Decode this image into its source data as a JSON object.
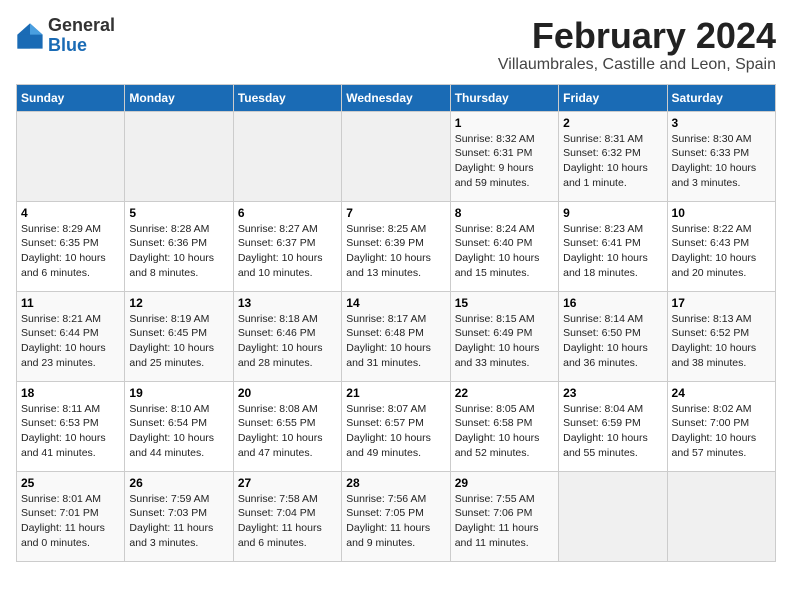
{
  "header": {
    "logo_general": "General",
    "logo_blue": "Blue",
    "month_title": "February 2024",
    "location": "Villaumbrales, Castille and Leon, Spain"
  },
  "columns": [
    "Sunday",
    "Monday",
    "Tuesday",
    "Wednesday",
    "Thursday",
    "Friday",
    "Saturday"
  ],
  "weeks": [
    [
      {
        "day": "",
        "info": ""
      },
      {
        "day": "",
        "info": ""
      },
      {
        "day": "",
        "info": ""
      },
      {
        "day": "",
        "info": ""
      },
      {
        "day": "1",
        "info": "Sunrise: 8:32 AM\nSunset: 6:31 PM\nDaylight: 9 hours\nand 59 minutes."
      },
      {
        "day": "2",
        "info": "Sunrise: 8:31 AM\nSunset: 6:32 PM\nDaylight: 10 hours\nand 1 minute."
      },
      {
        "day": "3",
        "info": "Sunrise: 8:30 AM\nSunset: 6:33 PM\nDaylight: 10 hours\nand 3 minutes."
      }
    ],
    [
      {
        "day": "4",
        "info": "Sunrise: 8:29 AM\nSunset: 6:35 PM\nDaylight: 10 hours\nand 6 minutes."
      },
      {
        "day": "5",
        "info": "Sunrise: 8:28 AM\nSunset: 6:36 PM\nDaylight: 10 hours\nand 8 minutes."
      },
      {
        "day": "6",
        "info": "Sunrise: 8:27 AM\nSunset: 6:37 PM\nDaylight: 10 hours\nand 10 minutes."
      },
      {
        "day": "7",
        "info": "Sunrise: 8:25 AM\nSunset: 6:39 PM\nDaylight: 10 hours\nand 13 minutes."
      },
      {
        "day": "8",
        "info": "Sunrise: 8:24 AM\nSunset: 6:40 PM\nDaylight: 10 hours\nand 15 minutes."
      },
      {
        "day": "9",
        "info": "Sunrise: 8:23 AM\nSunset: 6:41 PM\nDaylight: 10 hours\nand 18 minutes."
      },
      {
        "day": "10",
        "info": "Sunrise: 8:22 AM\nSunset: 6:43 PM\nDaylight: 10 hours\nand 20 minutes."
      }
    ],
    [
      {
        "day": "11",
        "info": "Sunrise: 8:21 AM\nSunset: 6:44 PM\nDaylight: 10 hours\nand 23 minutes."
      },
      {
        "day": "12",
        "info": "Sunrise: 8:19 AM\nSunset: 6:45 PM\nDaylight: 10 hours\nand 25 minutes."
      },
      {
        "day": "13",
        "info": "Sunrise: 8:18 AM\nSunset: 6:46 PM\nDaylight: 10 hours\nand 28 minutes."
      },
      {
        "day": "14",
        "info": "Sunrise: 8:17 AM\nSunset: 6:48 PM\nDaylight: 10 hours\nand 31 minutes."
      },
      {
        "day": "15",
        "info": "Sunrise: 8:15 AM\nSunset: 6:49 PM\nDaylight: 10 hours\nand 33 minutes."
      },
      {
        "day": "16",
        "info": "Sunrise: 8:14 AM\nSunset: 6:50 PM\nDaylight: 10 hours\nand 36 minutes."
      },
      {
        "day": "17",
        "info": "Sunrise: 8:13 AM\nSunset: 6:52 PM\nDaylight: 10 hours\nand 38 minutes."
      }
    ],
    [
      {
        "day": "18",
        "info": "Sunrise: 8:11 AM\nSunset: 6:53 PM\nDaylight: 10 hours\nand 41 minutes."
      },
      {
        "day": "19",
        "info": "Sunrise: 8:10 AM\nSunset: 6:54 PM\nDaylight: 10 hours\nand 44 minutes."
      },
      {
        "day": "20",
        "info": "Sunrise: 8:08 AM\nSunset: 6:55 PM\nDaylight: 10 hours\nand 47 minutes."
      },
      {
        "day": "21",
        "info": "Sunrise: 8:07 AM\nSunset: 6:57 PM\nDaylight: 10 hours\nand 49 minutes."
      },
      {
        "day": "22",
        "info": "Sunrise: 8:05 AM\nSunset: 6:58 PM\nDaylight: 10 hours\nand 52 minutes."
      },
      {
        "day": "23",
        "info": "Sunrise: 8:04 AM\nSunset: 6:59 PM\nDaylight: 10 hours\nand 55 minutes."
      },
      {
        "day": "24",
        "info": "Sunrise: 8:02 AM\nSunset: 7:00 PM\nDaylight: 10 hours\nand 57 minutes."
      }
    ],
    [
      {
        "day": "25",
        "info": "Sunrise: 8:01 AM\nSunset: 7:01 PM\nDaylight: 11 hours\nand 0 minutes."
      },
      {
        "day": "26",
        "info": "Sunrise: 7:59 AM\nSunset: 7:03 PM\nDaylight: 11 hours\nand 3 minutes."
      },
      {
        "day": "27",
        "info": "Sunrise: 7:58 AM\nSunset: 7:04 PM\nDaylight: 11 hours\nand 6 minutes."
      },
      {
        "day": "28",
        "info": "Sunrise: 7:56 AM\nSunset: 7:05 PM\nDaylight: 11 hours\nand 9 minutes."
      },
      {
        "day": "29",
        "info": "Sunrise: 7:55 AM\nSunset: 7:06 PM\nDaylight: 11 hours\nand 11 minutes."
      },
      {
        "day": "",
        "info": ""
      },
      {
        "day": "",
        "info": ""
      }
    ]
  ]
}
